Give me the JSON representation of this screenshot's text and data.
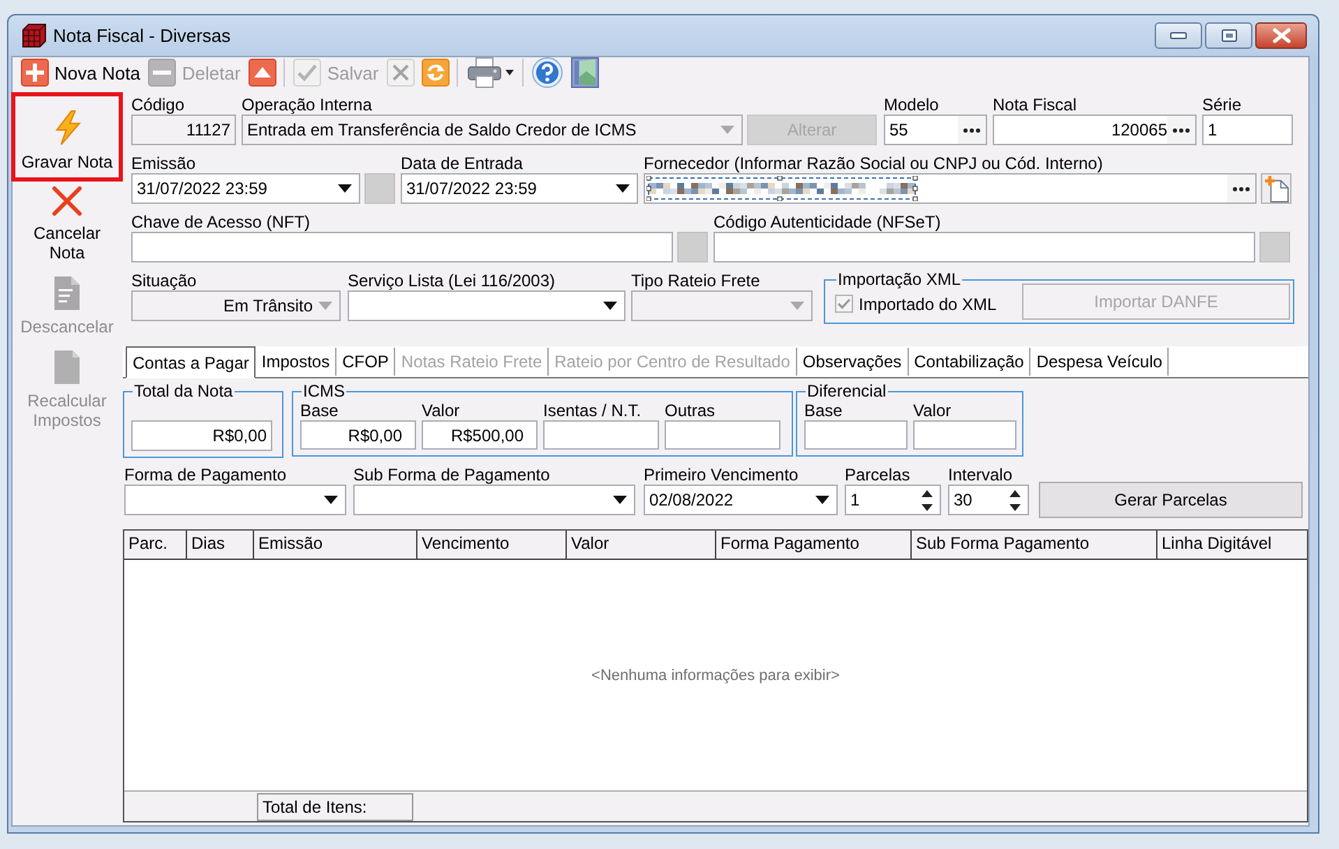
{
  "window": {
    "title": "Nota Fiscal - Diversas"
  },
  "toolbar": {
    "groups": [
      {
        "items": [
          {
            "kind": "add",
            "label": "Nova Nota",
            "disabled": false
          },
          {
            "kind": "delete",
            "label": "Deletar",
            "disabled": true
          },
          {
            "kind": "up",
            "disabled": false
          }
        ]
      },
      {
        "items": [
          {
            "kind": "save",
            "label": "Salvar",
            "disabled": true
          },
          {
            "kind": "cancel",
            "disabled": true
          },
          {
            "kind": "refresh",
            "disabled": false
          }
        ]
      },
      {
        "items": [
          {
            "kind": "print",
            "disabled": false
          }
        ]
      },
      {
        "items": [
          {
            "kind": "help",
            "disabled": false
          },
          {
            "kind": "exit",
            "disabled": false
          }
        ]
      }
    ]
  },
  "sidebar": {
    "items": [
      {
        "kind": "record",
        "label": "Gravar Nota",
        "disabled": false,
        "highlighted": true
      },
      {
        "kind": "cancel",
        "label": "Cancelar Nota",
        "disabled": false,
        "highlighted": false
      },
      {
        "kind": "uncancel",
        "label": "Descancelar",
        "disabled": true,
        "highlighted": false
      },
      {
        "kind": "recalc",
        "label": "Recalcular Impostos",
        "disabled": true,
        "highlighted": false
      }
    ]
  },
  "form": {
    "codigo": {
      "label": "Código",
      "value": "11127",
      "readonly": true
    },
    "operacao_interna": {
      "label": "Operação Interna",
      "value": "Entrada em Transferência de Saldo Credor de ICMS",
      "disabled": true
    },
    "alterar": {
      "label": "Alterar",
      "disabled": true
    },
    "modelo": {
      "label": "Modelo",
      "value": "55"
    },
    "nota_fiscal": {
      "label": "Nota Fiscal",
      "value": "120065"
    },
    "serie": {
      "label": "Série",
      "value": "1"
    },
    "emissao": {
      "label": "Emissão",
      "value": "31/07/2022 23:59"
    },
    "data_de_entrada": {
      "label": "Data de Entrada",
      "value": "31/07/2022 23:59"
    },
    "fornecedor": {
      "label": "Fornecedor (Informar Razão Social ou CNPJ ou Cód. Interno)",
      "redacted": true
    },
    "chave_de_acesso": {
      "label": "Chave de Acesso (NFT)"
    },
    "codigo_autenticidade": {
      "label": "Código Autenticidade (NFSeT)"
    },
    "situacao": {
      "label": "Situação",
      "value": "Em Trânsito",
      "disabled": true
    },
    "servico_lista": {
      "label": "Serviço Lista (Lei 116/2003)",
      "disabled": false
    },
    "tipo_rateio_frete": {
      "label": "Tipo Rateio Frete",
      "disabled": true
    },
    "importacao_xml": {
      "title": "Importação XML",
      "importado": {
        "label": "Importado do XML",
        "checked": true,
        "disabled": true
      },
      "importar_danfe": {
        "label": "Importar DANFE",
        "disabled": true
      }
    }
  },
  "tabs": [
    {
      "label": "Contas a Pagar",
      "selected": true,
      "disabled": false
    },
    {
      "label": "Impostos",
      "selected": false,
      "disabled": false
    },
    {
      "label": "CFOP",
      "selected": false,
      "disabled": false
    },
    {
      "label": "Notas Rateio Frete",
      "selected": false,
      "disabled": true
    },
    {
      "label": "Rateio por Centro de Resultado",
      "selected": false,
      "disabled": true
    },
    {
      "label": "Observações",
      "selected": false,
      "disabled": false
    },
    {
      "label": "Contabilização",
      "selected": false,
      "disabled": false
    },
    {
      "label": "Despesa Veículo",
      "selected": false,
      "disabled": false
    }
  ],
  "contas_a_pagar": {
    "total_da_nota": {
      "title": "Total da Nota",
      "value": "R$0,00"
    },
    "icms": {
      "title": "ICMS",
      "fields": [
        {
          "label": "Base",
          "value": "R$0,00"
        },
        {
          "label": "Valor",
          "value": "R$500,00"
        },
        {
          "label": "Isentas / N.T."
        },
        {
          "label": "Outras"
        }
      ]
    },
    "diferencial": {
      "title": "Diferencial",
      "fields": [
        {
          "label": "Base"
        },
        {
          "label": "Valor"
        }
      ]
    },
    "forma_de_pagamento": {
      "label": "Forma de Pagamento"
    },
    "sub_forma_de_pagamento": {
      "label": "Sub Forma de Pagamento"
    },
    "primeiro_vencimento": {
      "label": "Primeiro Vencimento",
      "value": "02/08/2022"
    },
    "parcelas": {
      "label": "Parcelas",
      "value": "1"
    },
    "intervalo": {
      "label": "Intervalo",
      "value": "30"
    },
    "gerar_parcelas": {
      "label": "Gerar Parcelas"
    },
    "table": {
      "columns": [
        "Parc.",
        "Dias",
        "Emissão",
        "Vencimento",
        "Valor",
        "Forma Pagamento",
        "Sub Forma Pagamento",
        "Linha Digitável"
      ],
      "empty_message": "<Nenhuma informações para exibir>",
      "footer": "Total de Itens:"
    }
  }
}
